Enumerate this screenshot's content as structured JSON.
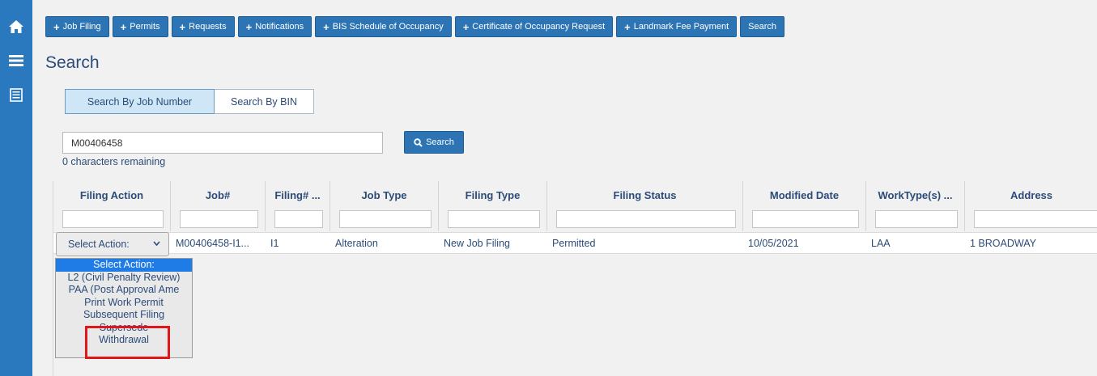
{
  "rail": {
    "icons": [
      "home-icon",
      "hamburger-menu-icon",
      "list-icon"
    ]
  },
  "nav": {
    "buttons": [
      {
        "label": "Job Filing",
        "plus": "+"
      },
      {
        "label": "Permits",
        "plus": "+"
      },
      {
        "label": "Requests",
        "plus": "+"
      },
      {
        "label": "Notifications",
        "plus": "+"
      },
      {
        "label": "BIS Schedule of Occupancy",
        "plus": "+"
      },
      {
        "label": "Certificate of Occupancy Request",
        "plus": "+"
      },
      {
        "label": "Landmark Fee Payment",
        "plus": "+"
      },
      {
        "label": "Search",
        "plus": ""
      }
    ]
  },
  "page": {
    "title": "Search"
  },
  "mode_tabs": {
    "by_job": "Search By Job Number",
    "by_bin": "Search By BIN"
  },
  "search": {
    "value": "M00406458",
    "remaining": "0 characters remaining",
    "button_label": "Search"
  },
  "grid": {
    "columns": [
      "Filing Action",
      "Job#",
      "Filing# ...",
      "Job Type",
      "Filing Type",
      "Filing Status",
      "Modified Date",
      "WorkType(s) ...",
      "Address"
    ],
    "row": {
      "job": "M00406458-I1...",
      "filing": "I1",
      "job_type": "Alteration",
      "filing_type": "New Job Filing",
      "status": "Permitted",
      "modified": "10/05/2021",
      "worktypes": "LAA",
      "address": "1 BROADWAY"
    },
    "select_label": "Select Action:"
  },
  "dropdown": {
    "options": [
      "Select Action:",
      "L2 (Civil Penalty Review)",
      "PAA (Post Approval Ame",
      "Print Work Permit",
      "Subsequent Filing",
      "Supersede",
      "Withdrawal"
    ]
  },
  "colors": {
    "rail": "#2a78bd",
    "primary_button": "#2d74b4",
    "text": "#2b4b78",
    "highlight": "#e0161b",
    "selected_option": "#1f7be5"
  }
}
